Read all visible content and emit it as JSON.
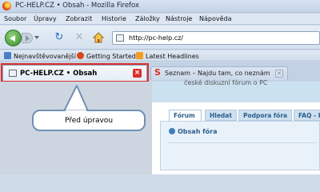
{
  "window": {
    "title": "PC-HELP.CZ • Obsah - Mozilla Firefox"
  },
  "menu": [
    "Soubor",
    "Úpravy",
    "Zobrazit",
    "Historie",
    "Záložky",
    "Nástroje",
    "Nápověda"
  ],
  "navigation": {
    "url": "http://pc-help.cz/"
  },
  "bookmarks": [
    "Nejnavštěvovanější",
    "Getting Started",
    "Latest Headlines"
  ],
  "tabs": [
    {
      "label": "PC-HELP.CZ • Obsah",
      "active": true,
      "close": "×"
    },
    {
      "label": "Seznam – Najdu tam, co neznám",
      "active": false,
      "close": "×"
    }
  ],
  "page": {
    "header_text": "české diskuzní fórum o PC",
    "forum_tabs": [
      "Fórum",
      "Hledat",
      "Podpora fóra",
      "FAQ - R"
    ],
    "section_title": "Obsah fóra"
  },
  "annotation": {
    "callout": "Před úpravou",
    "highlight_color": "#d9302b"
  },
  "icons": {
    "back": "back-arrow-icon",
    "reload": "reload-icon",
    "stop": "stop-icon",
    "home": "home-icon"
  }
}
